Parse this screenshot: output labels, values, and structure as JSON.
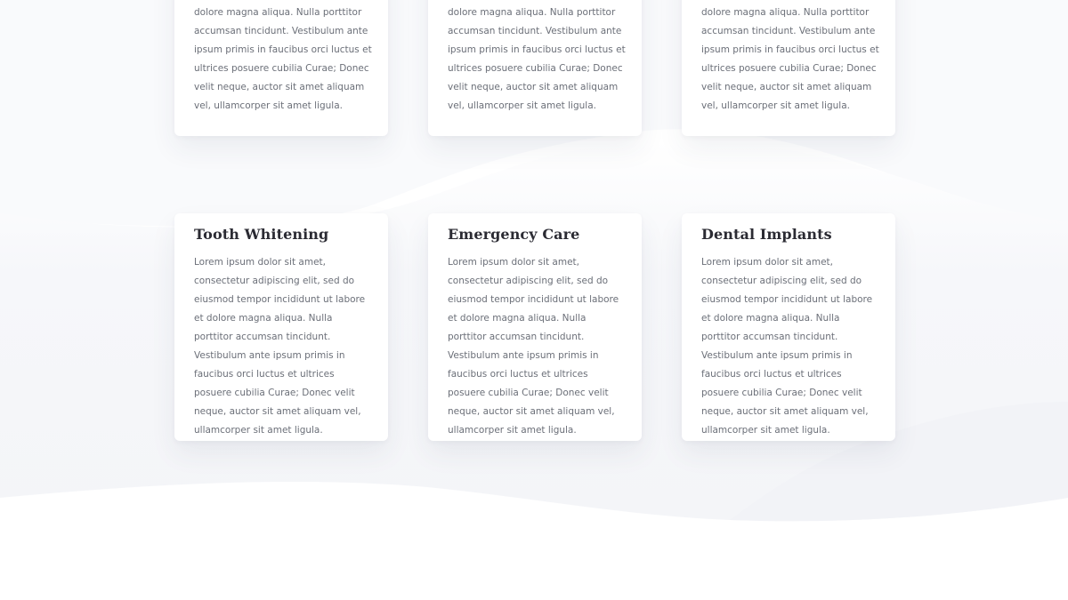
{
  "cards_top": [
    {
      "text": "dolore magna aliqua. Nulla porttitor accumsan tincidunt. Vestibulum ante ipsum primis in faucibus orci luctus et ultrices posuere cubilia Curae; Donec velit neque, auctor sit amet aliquam vel, ullamcorper sit amet ligula."
    },
    {
      "text": "dolore magna aliqua. Nulla porttitor accumsan tincidunt. Vestibulum ante ipsum primis in faucibus orci luctus et ultrices posuere cubilia Curae; Donec velit neque, auctor sit amet aliquam vel, ullamcorper sit amet ligula."
    },
    {
      "text": "dolore magna aliqua. Nulla porttitor accumsan tincidunt. Vestibulum ante ipsum primis in faucibus orci luctus et ultrices posuere cubilia Curae; Donec velit neque, auctor sit amet aliquam vel, ullamcorper sit amet ligula."
    }
  ],
  "cards_bottom": [
    {
      "title": "Tooth Whitening",
      "text": "Lorem ipsum dolor sit amet, consectetur adipiscing elit, sed do eiusmod tempor incididunt ut labore et dolore magna aliqua. Nulla porttitor accumsan tincidunt. Vestibulum ante ipsum primis in faucibus orci luctus et ultrices posuere cubilia Curae; Donec velit neque, auctor sit amet aliquam vel, ullamcorper sit amet ligula."
    },
    {
      "title": "Emergency Care",
      "text": "Lorem ipsum dolor sit amet, consectetur adipiscing elit, sed do eiusmod tempor incididunt ut labore et dolore magna aliqua. Nulla porttitor accumsan tincidunt. Vestibulum ante ipsum primis in faucibus orci luctus et ultrices posuere cubilia Curae; Donec velit neque, auctor sit amet aliquam vel, ullamcorper sit amet ligula."
    },
    {
      "title": "Dental Implants",
      "text": "Lorem ipsum dolor sit amet, consectetur adipiscing elit, sed do eiusmod tempor incididunt ut labore et dolore magna aliqua. Nulla porttitor accumsan tincidunt. Vestibulum ante ipsum primis in faucibus orci luctus et ultrices posuere cubilia Curae; Donec velit neque, auctor sit amet aliquam vel, ullamcorper sit amet ligula."
    }
  ],
  "colors": {
    "background": "#ffffff",
    "wave_band": "#f5f6f9",
    "title": "#2b2b33",
    "body_text": "#6b6f78"
  }
}
